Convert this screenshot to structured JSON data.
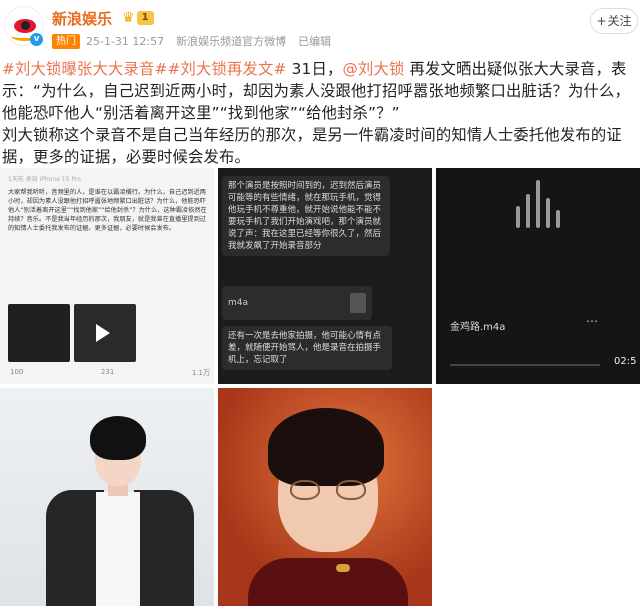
{
  "header": {
    "account_name": "新浪娱乐",
    "vip_level": "1",
    "badge": "热门",
    "timestamp": "25-1-31 12:57",
    "source": "新浪娱乐频道官方微博",
    "edited": "已编辑",
    "follow_label": "关注"
  },
  "post": {
    "tag1": "#刘大锁曝张大大录音#",
    "tag2": "#刘大锁再发文#",
    "p1_after_tags": " 31日，",
    "mention": "@刘大锁",
    "p1_rest": " 再发文晒出疑似张大大录音，表示：“为什么，自己迟到近两小时，却因为素人没跟他打招呼嚣张地频繁口出脏话？为什么，他能恐吓他人“别活着离开这里”“找到他家”“给他封杀”？”",
    "p2": "刘大锁称这个录音不是自己当年经历的那次，是另一件霸凌时间的知情人士委托他发布的证据，更多的证据，必要时候会发布。"
  },
  "images": {
    "img1": {
      "mini_head": "1天前 来自 iPhone 15 Pro",
      "mini_text": "大家帮我听听，音频里的人，是谁在以霸凌横行。为什么，自己迟到近两小时，却因为素人没跟他打招呼嚣张地频繁口出脏话？为什么，他能恐吓他人“别活着离开这里”“找到他家”“给他封杀”？为什么，这种霸凌依然在持续？音乐。不是我当年经历的那次，我朋友，就是我曾在直播里提到过的知情人士委托我发布的证据。更多证据，必要时候会发布。",
      "stat_repost": "100",
      "stat_comment": "231",
      "stat_like": "1.1万"
    },
    "img2": {
      "b1": "那个演员是按照时间到的，迟到然后演员可能等的有些情绪，就在那玩手机，觉得他玩手机不尊重他，就开始说他能不能不要玩手机了我们开始演戏吧，那个演员就说了声：我在这里已经等你很久了，然后我就发飙了开始录音部分",
      "b2": "m4a",
      "b3": "还有一次是去他家拍摄，他可能心情有点差，就随便开始骂人，他是录音在拍摄手机上，忘记取了"
    },
    "img3": {
      "file_name": "金鸡路.m4a",
      "duration": "02:5"
    }
  },
  "colors": {
    "accent": "#eb7350",
    "name": "#e96b1e",
    "hot_badge": "#ff8200",
    "verified": "#1e9bf0"
  }
}
